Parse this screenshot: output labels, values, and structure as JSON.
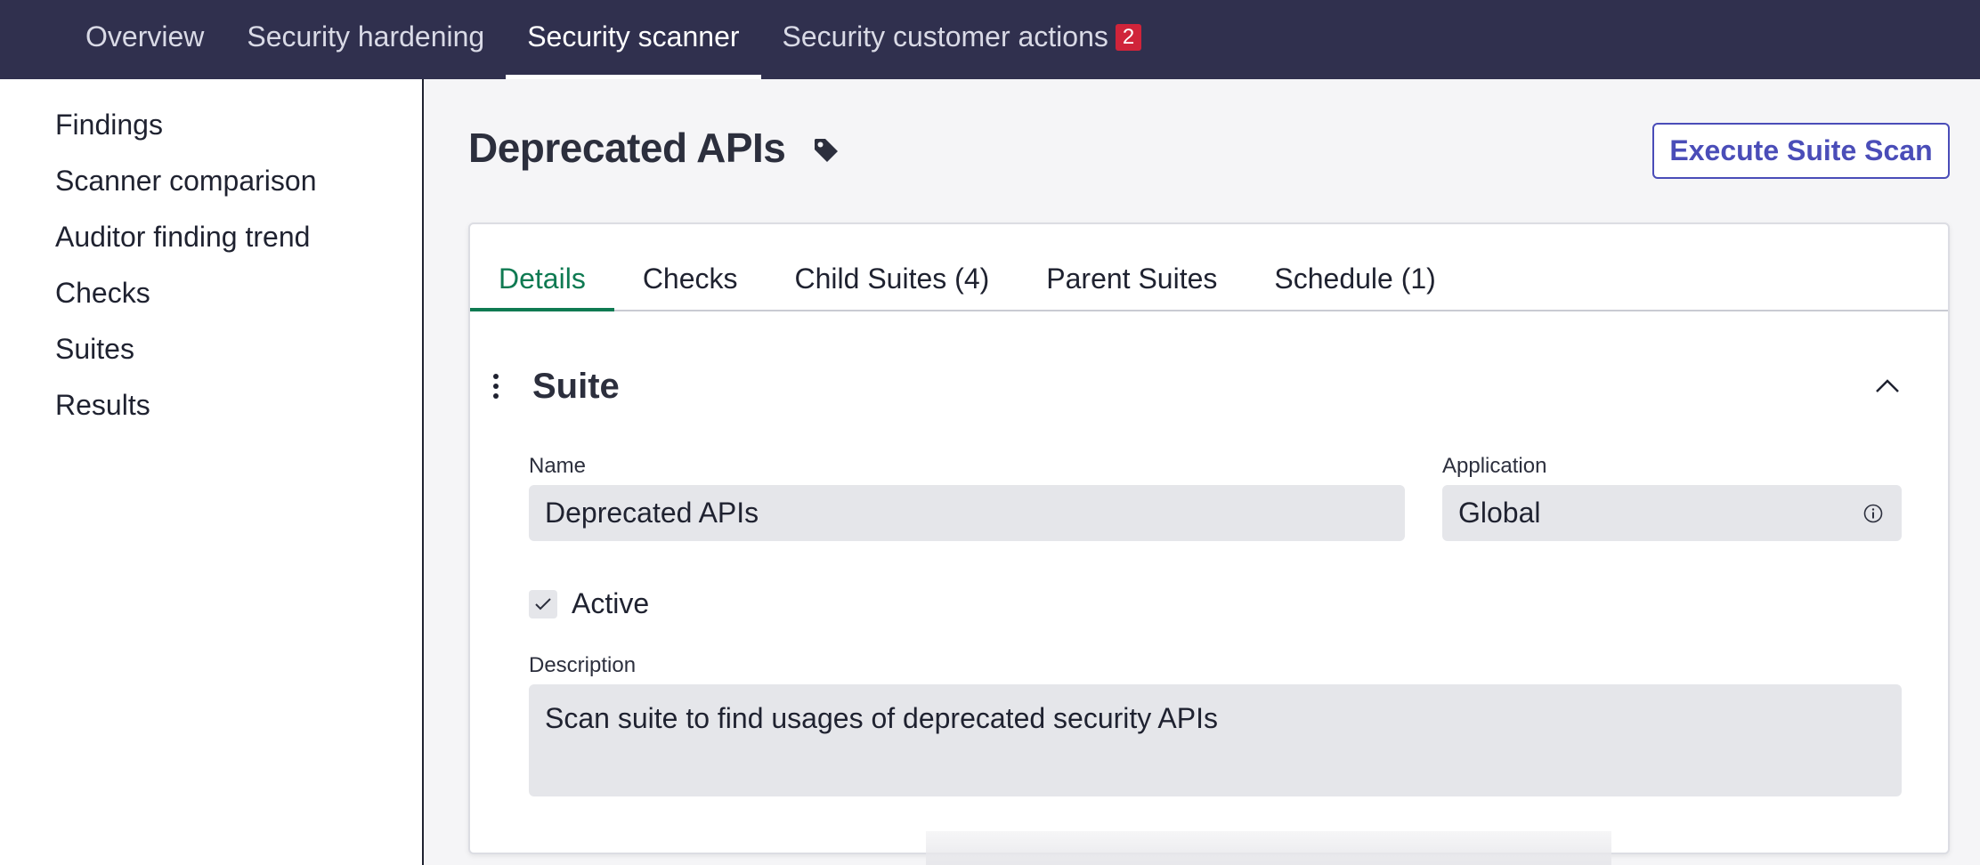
{
  "topnav": {
    "tabs": [
      {
        "label": "Overview"
      },
      {
        "label": "Security hardening"
      },
      {
        "label": "Security scanner",
        "active": true
      },
      {
        "label": "Security customer actions",
        "badge": "2"
      }
    ]
  },
  "sidebar": {
    "items": [
      {
        "label": "Findings"
      },
      {
        "label": "Scanner comparison"
      },
      {
        "label": "Auditor finding trend"
      },
      {
        "label": "Checks"
      },
      {
        "label": "Suites"
      },
      {
        "label": "Results"
      }
    ]
  },
  "header": {
    "title": "Deprecated APIs",
    "tag_icon": "tag-icon",
    "execute_label": "Execute Suite Scan"
  },
  "tabs": [
    {
      "label": "Details",
      "active": true
    },
    {
      "label": "Checks"
    },
    {
      "label": "Child Suites (4)"
    },
    {
      "label": "Parent Suites"
    },
    {
      "label": "Schedule (1)"
    }
  ],
  "suite": {
    "section_title": "Suite",
    "name_label": "Name",
    "name_value": "Deprecated APIs",
    "application_label": "Application",
    "application_value": "Global",
    "active_label": "Active",
    "active_checked": true,
    "description_label": "Description",
    "description_value": "Scan suite to find usages of deprecated security APIs"
  },
  "colors": {
    "nav_bg": "#30304e",
    "accent_green": "#0f7a52",
    "accent_purple": "#4a4db8",
    "badge_red": "#d0243a"
  }
}
